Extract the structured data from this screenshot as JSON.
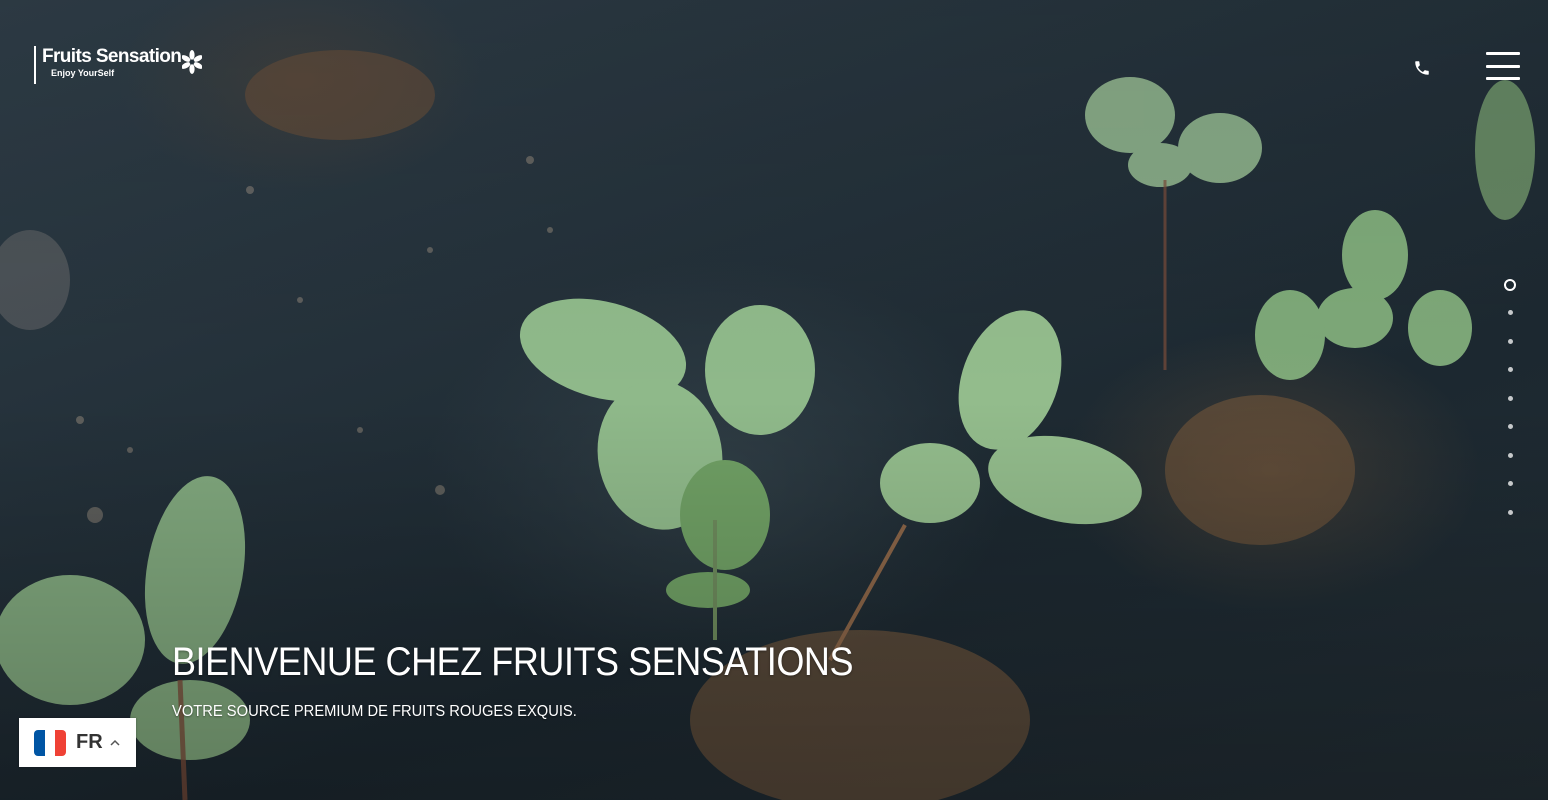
{
  "header": {
    "logo": {
      "name": "Fruits Sensation",
      "tagline": "Enjoy YourSelf"
    },
    "phone_icon": "phone-icon",
    "menu_icon": "hamburger-menu-icon"
  },
  "hero": {
    "title": "BIENVENUE CHEZ FRUITS SENSATIONS",
    "subtitle": "VOTRE SOURCE PREMIUM DE FRUITS ROUGES EXQUIS.",
    "slides": {
      "count": 9,
      "active_index": 0
    }
  },
  "language": {
    "code": "FR",
    "flag_colors": [
      "#0055a4",
      "#ffffff",
      "#ef4135"
    ],
    "caret_icon": "chevron-up-icon"
  },
  "colors": {
    "text": "#ffffff",
    "background": "#24313a",
    "leaf": "#8bb585"
  }
}
